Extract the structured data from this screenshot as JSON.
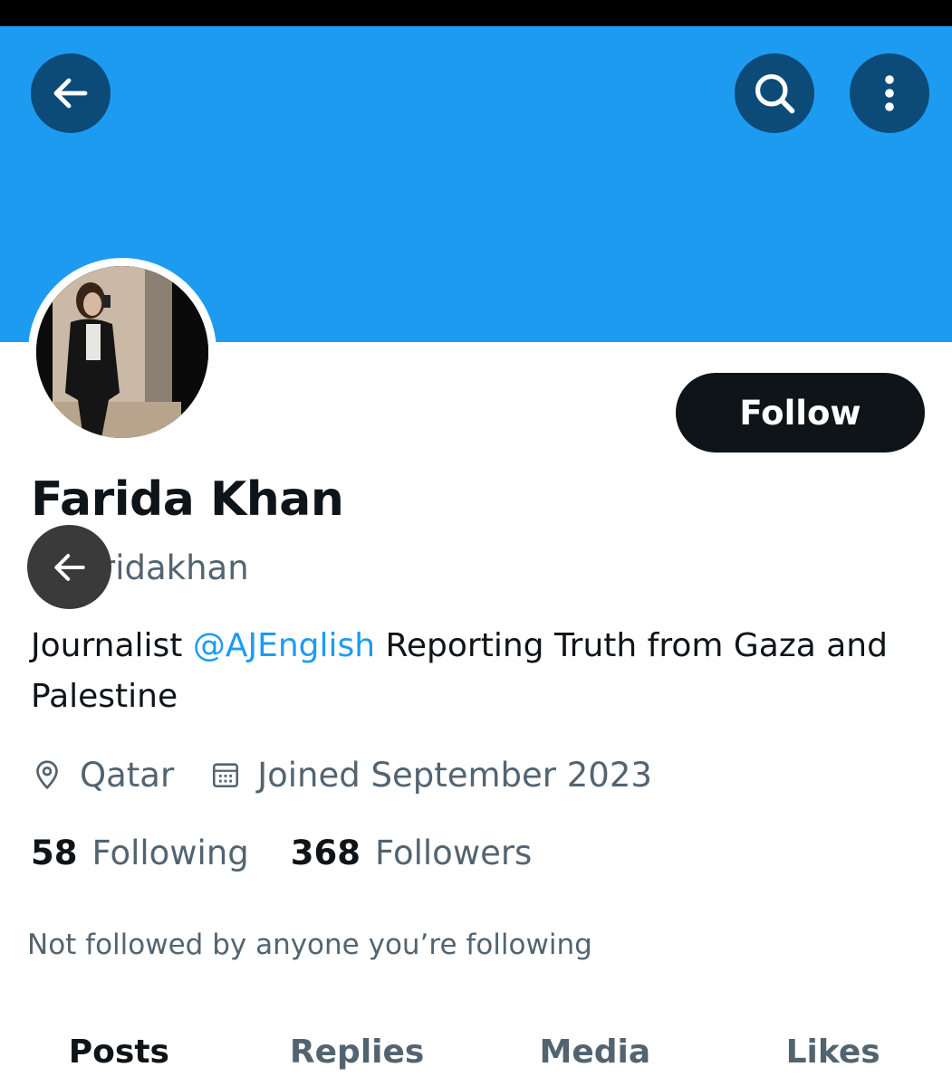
{
  "colors": {
    "banner": "#1d9bf0",
    "header_button": "#0c4a78",
    "follow_button": "#0f1419",
    "mention": "#1d9bf0",
    "secondary_text": "#536471",
    "overlay_button": "#3a3a3a"
  },
  "header": {
    "back_icon": "arrow-left-icon",
    "search_icon": "search-icon",
    "more_icon": "more-vertical-icon"
  },
  "profile": {
    "display_name": "Farida Khan",
    "handle_visible": "ridakhan",
    "follow_label": "Follow",
    "bio_prefix": "Journalist ",
    "bio_mention": "@AJEnglish",
    "bio_suffix": " Reporting Truth from Gaza and Palestine",
    "location": "Qatar",
    "joined": "Joined September 2023",
    "location_icon": "location-pin-icon",
    "calendar_icon": "calendar-icon",
    "following_count": "58",
    "following_label": "Following",
    "followers_count": "368",
    "followers_label": "Followers",
    "not_followed_note": "Not followed by anyone you’re following"
  },
  "overlay": {
    "back_icon": "arrow-left-icon"
  },
  "tabs": [
    {
      "label": "Posts",
      "active": true
    },
    {
      "label": "Replies",
      "active": false
    },
    {
      "label": "Media",
      "active": false
    },
    {
      "label": "Likes",
      "active": false
    }
  ]
}
